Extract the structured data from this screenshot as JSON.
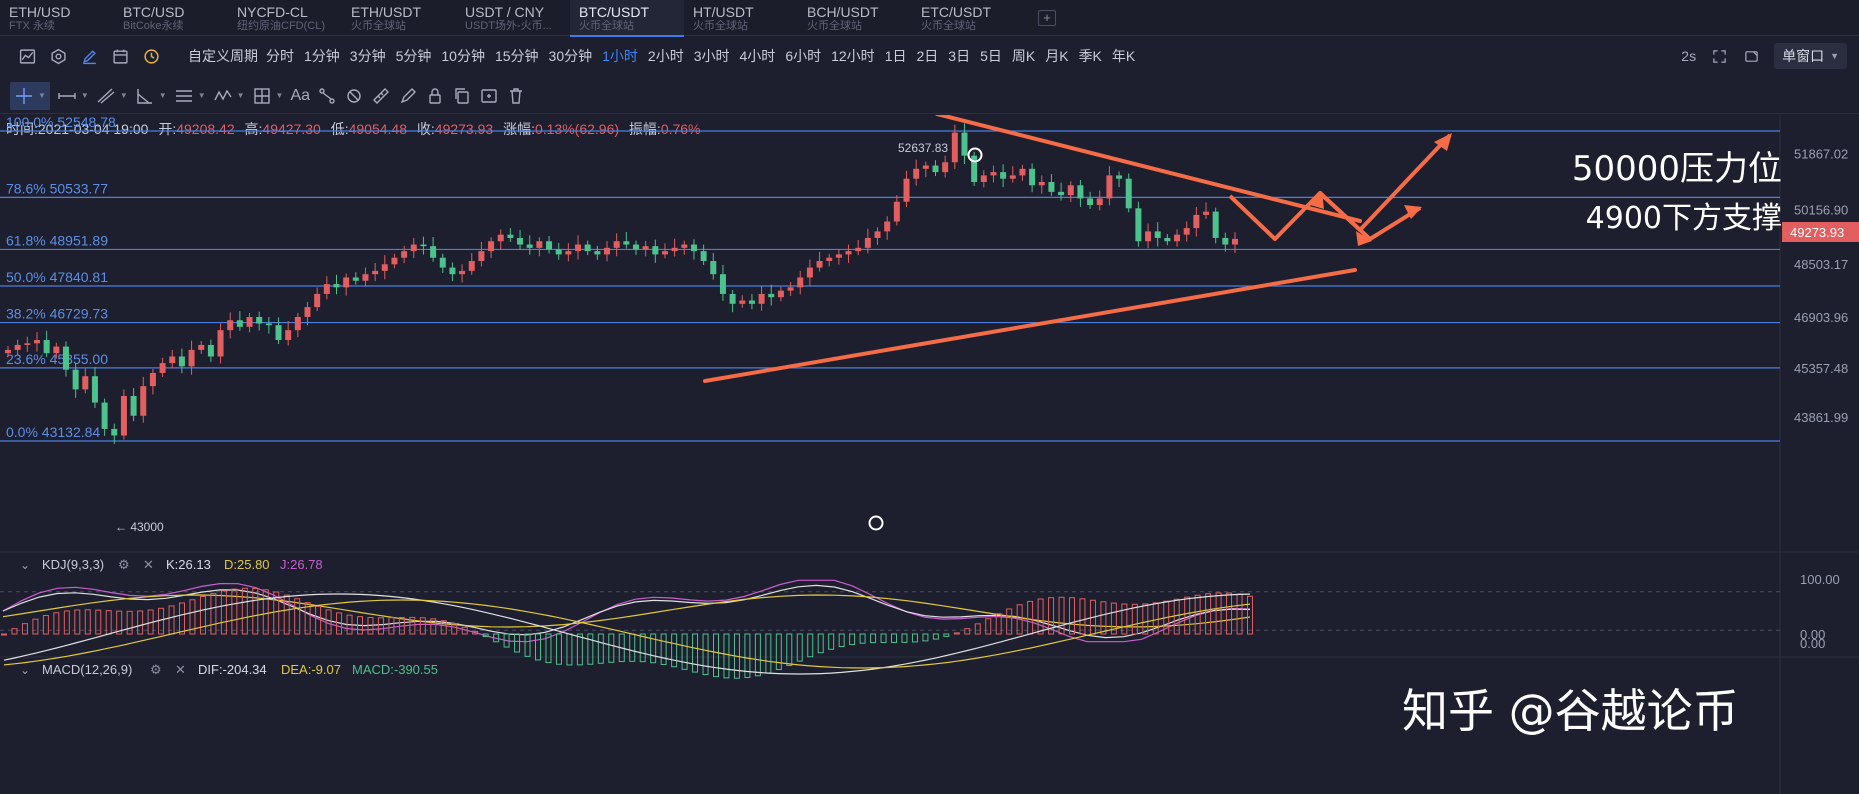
{
  "tabs": [
    {
      "symbol": "ETH/USD",
      "sub": "FTX 永续",
      "active": false
    },
    {
      "symbol": "BTC/USD",
      "sub": "BitCoke永续",
      "active": false
    },
    {
      "symbol": "NYCFD-CL",
      "sub": "纽约原油CFD(CL)",
      "active": false
    },
    {
      "symbol": "ETH/USDT",
      "sub": "火币全球站",
      "active": false
    },
    {
      "symbol": "USDT / CNY",
      "sub": "USDT场外-火币...",
      "active": false
    },
    {
      "symbol": "BTC/USDT",
      "sub": "火币全球站",
      "active": true
    },
    {
      "symbol": "HT/USDT",
      "sub": "火币全球站",
      "active": false
    },
    {
      "symbol": "BCH/USDT",
      "sub": "火币全球站",
      "active": false
    },
    {
      "symbol": "ETC/USDT",
      "sub": "火币全球站",
      "active": false
    }
  ],
  "toolbar1": {
    "icons": [
      "area-chart-icon",
      "hexagon-settings-icon",
      "pen-draw-icon",
      "calendar-icon",
      "clock-coin-icon"
    ],
    "period_label": "自定义周期",
    "periods": [
      "分时",
      "1分钟",
      "3分钟",
      "5分钟",
      "10分钟",
      "15分钟",
      "30分钟",
      "1小时",
      "2小时",
      "3小时",
      "4小时",
      "6小时",
      "12小时",
      "1日",
      "2日",
      "3日",
      "5日",
      "周K",
      "月K",
      "季K",
      "年K"
    ],
    "active_period": "1小时",
    "speed": "2s",
    "window_label": "单窗口"
  },
  "info_bar": {
    "time_label": "时间:",
    "time": "2021-03-04 19:00",
    "open_label": "开:",
    "open": "49208.42",
    "high_label": "高:",
    "high": "49427.30",
    "low_label": "低:",
    "low": "49054.48",
    "close_label": "收:",
    "close": "49273.93",
    "change_label": "涨幅:",
    "change": "0.13%(62.96)",
    "amp_label": "振幅:",
    "amp": "0.76%"
  },
  "fib_levels": [
    {
      "label": "100.0% 52548.78",
      "price": 52548.78
    },
    {
      "label": "78.6% 50533.77",
      "price": 50533.77
    },
    {
      "label": "61.8% 48951.89",
      "price": 48951.89
    },
    {
      "label": "50.0% 47840.81",
      "price": 47840.81
    },
    {
      "label": "38.2% 46729.73",
      "price": 46729.73
    },
    {
      "label": "23.6% 45355.00",
      "price": 45355.0
    },
    {
      "label": "0.0% 43132.84",
      "price": 43132.84
    }
  ],
  "price_axis": [
    "51867.02",
    "50156.90",
    "48503.17",
    "46903.96",
    "45357.48",
    "43861.99"
  ],
  "current_price": "49273.93",
  "markers": {
    "high_label": "52637.83",
    "low_label": "← 43000"
  },
  "annotations": {
    "resistance": "50000压力位",
    "support": "4900下方支撑"
  },
  "kdj": {
    "label": "KDJ(9,3,3)",
    "k": "K:26.13",
    "d": "D:25.80",
    "j": "J:26.78",
    "axis": [
      "100.00",
      "0.00"
    ]
  },
  "macd": {
    "label": "MACD(12,26,9)",
    "dif": "DIF:-204.34",
    "dea": "DEA:-9.07",
    "macd": "MACD:-390.55",
    "axis": [
      "0.00"
    ]
  },
  "watermark": "知乎 @谷越论币",
  "colors": {
    "up": "#e35e5e",
    "down": "#4cc28c",
    "fib": "#4a7fe0",
    "trend": "#f56c46",
    "k": "#e0e0e0",
    "d": "#e0c93c",
    "j": "#c95fcf"
  }
}
